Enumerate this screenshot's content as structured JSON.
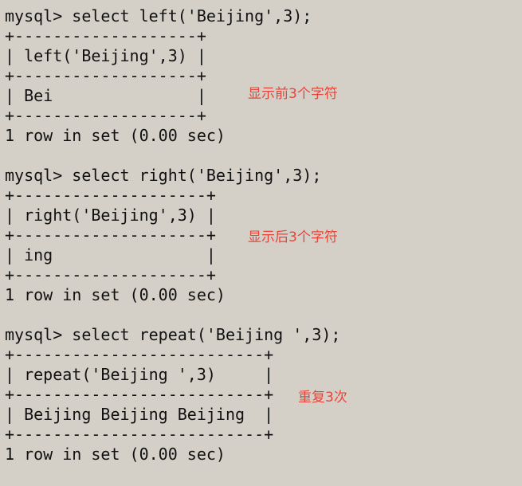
{
  "terminal": {
    "blocks": [
      {
        "command": "mysql> select left('Beijing',3);",
        "border": "+-------------------+",
        "header": "| left('Beijing',3) |",
        "row": "| Bei               |",
        "status": "1 row in set (0.00 sec)",
        "annotation": "显示前3个字符"
      },
      {
        "command": "mysql> select right('Beijing',3);",
        "border": "+--------------------+",
        "header": "| right('Beijing',3) |",
        "row": "| ing                |",
        "status": "1 row in set (0.00 sec)",
        "annotation": "显示后3个字符"
      },
      {
        "command": "mysql> select repeat('Beijing ',3);",
        "border": "+--------------------------+",
        "header": "| repeat('Beijing ',3)     |",
        "row": "| Beijing Beijing Beijing  |",
        "status": "1 row in set (0.00 sec)",
        "annotation": "重复3次"
      }
    ]
  },
  "colors": {
    "background": "#d4d0c8",
    "text": "#111111",
    "annotation": "#e8443a"
  }
}
